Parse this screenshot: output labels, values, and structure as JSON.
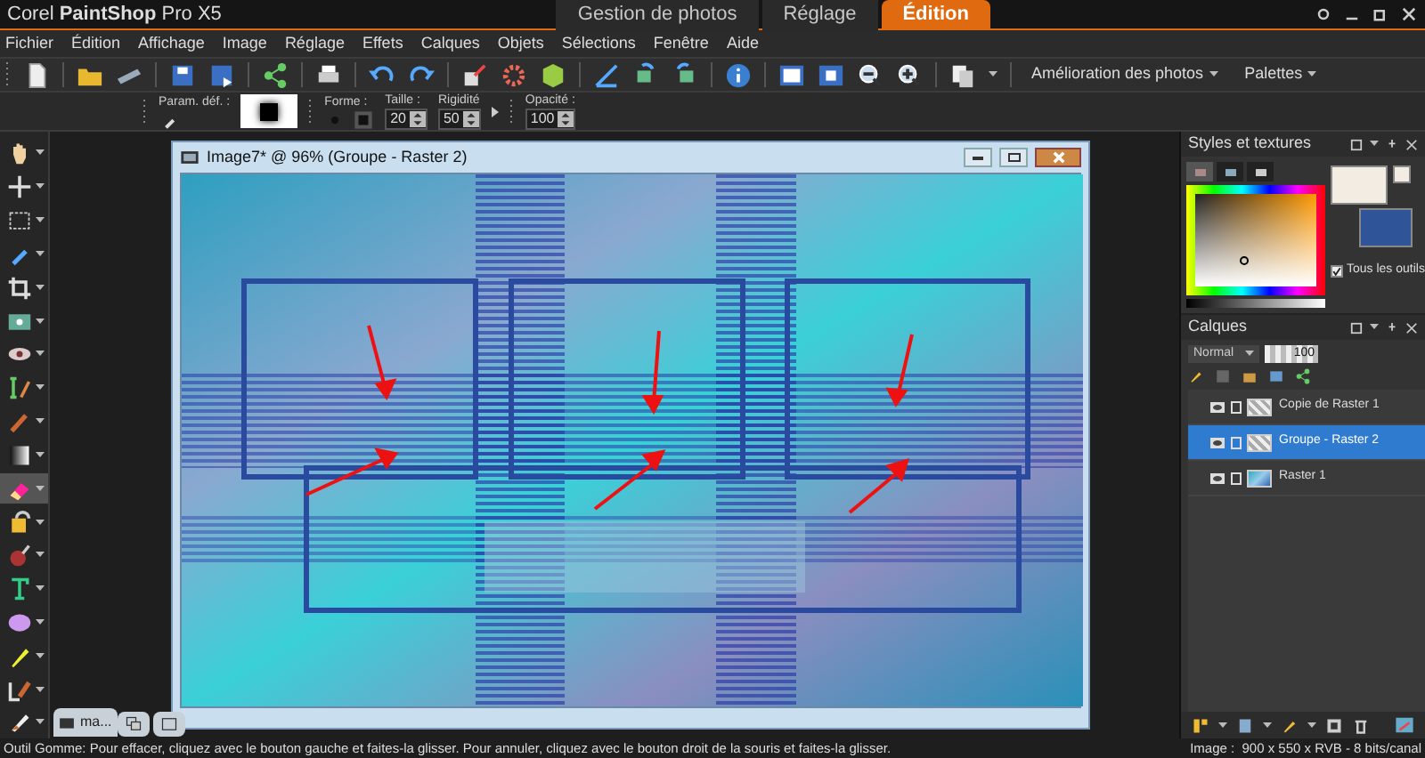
{
  "app_title": {
    "light": "Corel ",
    "bold": "PaintShop",
    "rest": " Pro X5"
  },
  "workspace_tabs": [
    {
      "label": "Gestion de photos",
      "selected": false
    },
    {
      "label": "Réglage",
      "selected": false
    },
    {
      "label": "Édition",
      "selected": true
    }
  ],
  "menu": [
    "Fichier",
    "Édition",
    "Affichage",
    "Image",
    "Réglage",
    "Effets",
    "Calques",
    "Objets",
    "Sélections",
    "Fenêtre",
    "Aide"
  ],
  "toolbar": {
    "menus": [
      "Amélioration des photos",
      "Palettes"
    ]
  },
  "tool_options": {
    "preset_label": "Param. déf. :",
    "shape_label": "Forme :",
    "size_label": "Taille :",
    "size": "20",
    "hardness_label": "Rigidité",
    "hardness": "50",
    "opacity_label": "Opacité :",
    "opacity": "100"
  },
  "document": {
    "title": "Image7* @ 96% (Groupe - Raster 2)",
    "tab_label": "ma..."
  },
  "styles_panel": {
    "title": "Styles et textures",
    "frame_tabs": [
      {
        "selected": true
      },
      {
        "selected": false
      },
      {
        "selected": false
      }
    ],
    "all_tools": {
      "label": "Tous les outils",
      "checked": true
    }
  },
  "layers_panel": {
    "title": "Calques",
    "blend_mode": "Normal",
    "opacity": "100",
    "layers": [
      {
        "name": "Copie de Raster 1",
        "selected": false
      },
      {
        "name": "Groupe - Raster 2",
        "selected": true
      },
      {
        "name": "Raster 1",
        "selected": false
      }
    ]
  },
  "status_bar": {
    "hint": "Outil Gomme: Pour effacer, cliquez avec le bouton gauche et faites-la glisser. Pour annuler, cliquez avec le bouton droit de la souris et faites-la glisser.",
    "image_info": "Image :  900 x 550 x RVB - 8 bits/canal"
  }
}
